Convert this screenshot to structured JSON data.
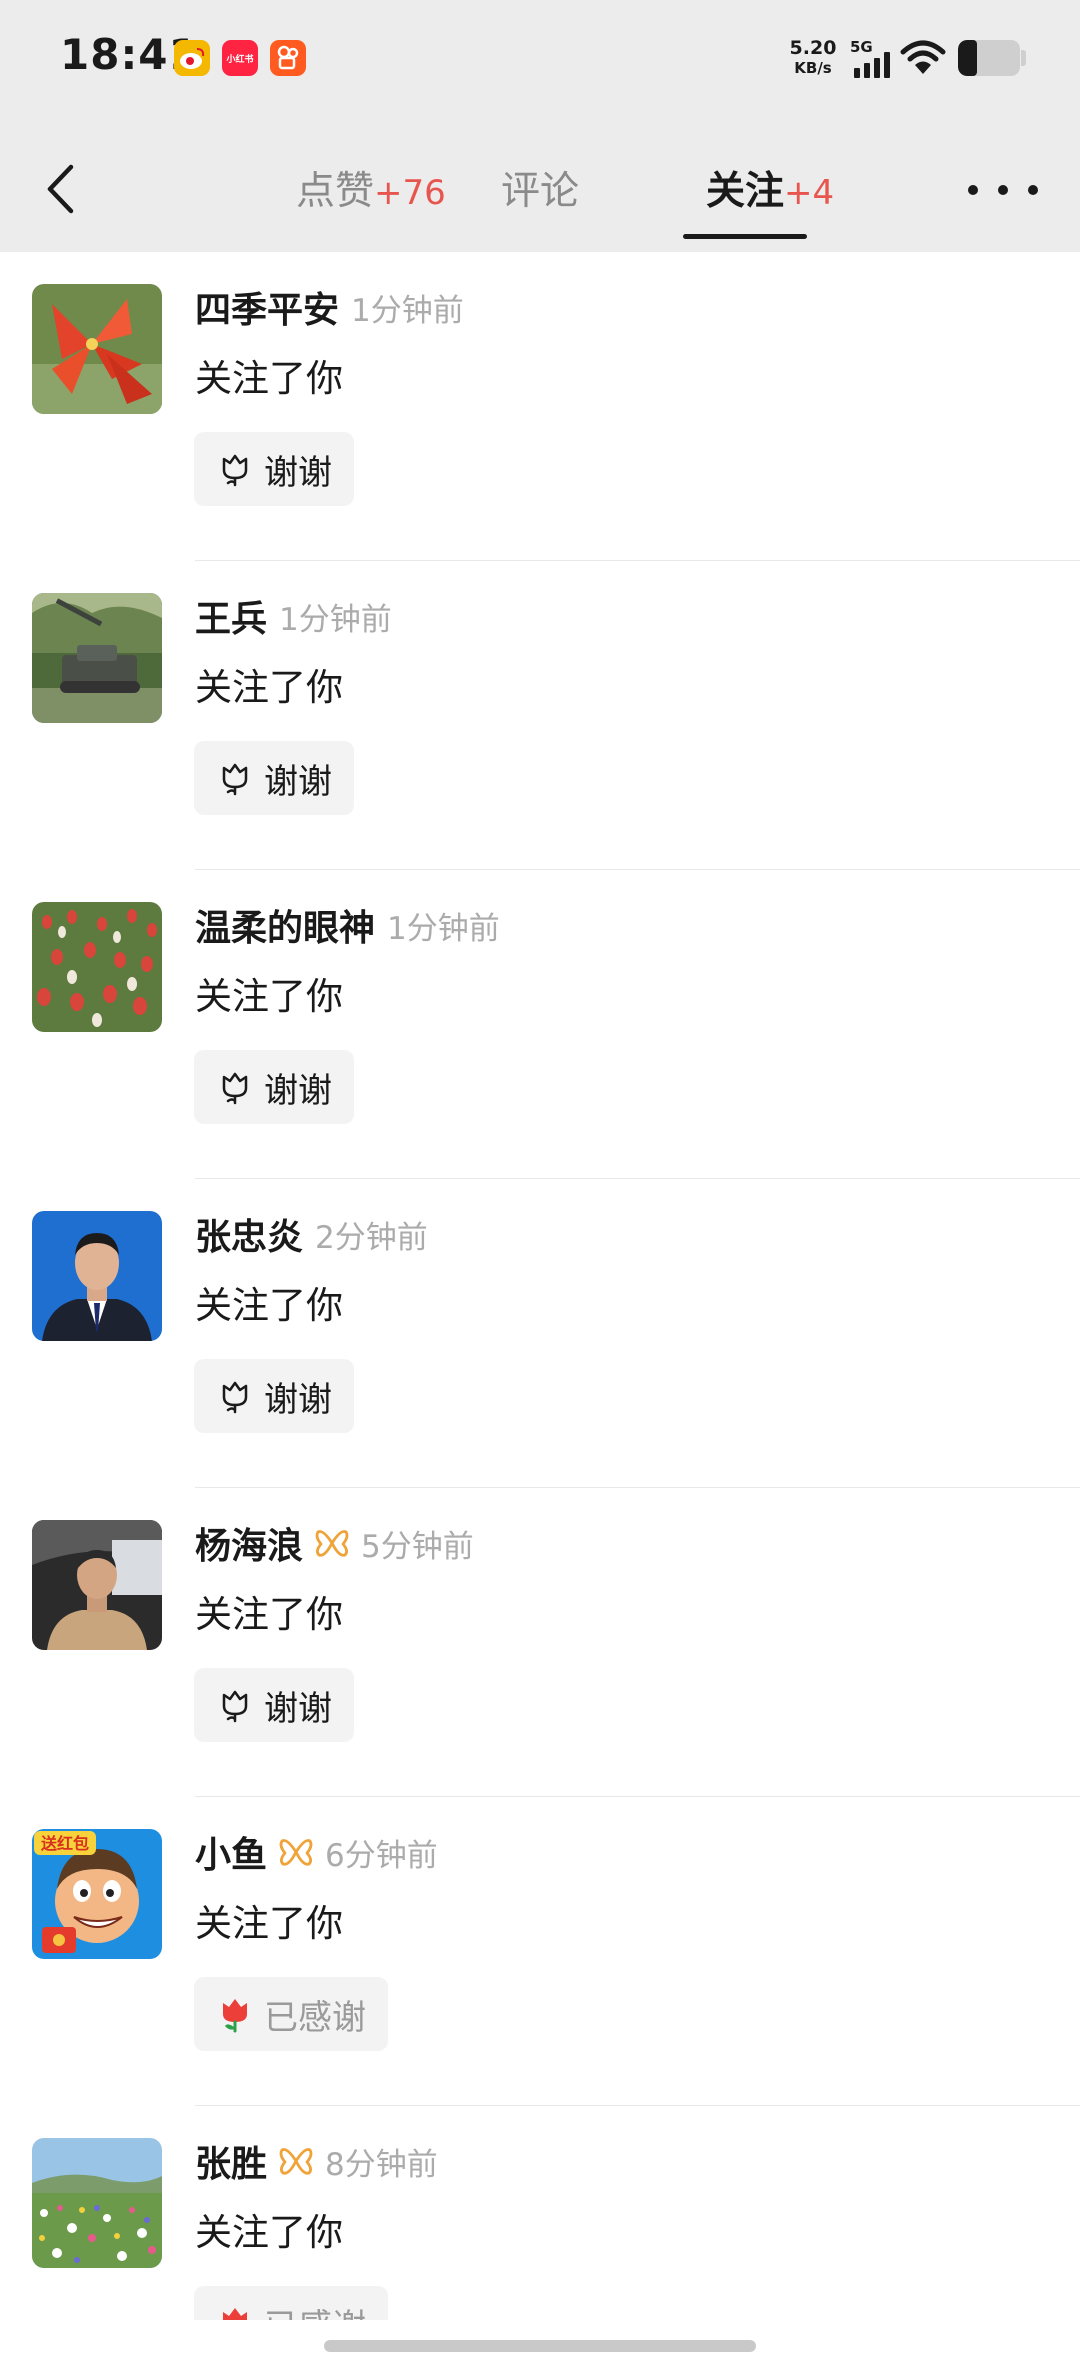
{
  "status_bar": {
    "time": "18:41",
    "app_icons": [
      {
        "name": "weibo-icon",
        "color": "#f5b800"
      },
      {
        "name": "xiaohongshu-icon",
        "label": "小红书",
        "color": "#ff2442"
      },
      {
        "name": "kuaishou-icon",
        "color": "#ff5a1f"
      }
    ],
    "net_speed": "5.20",
    "net_speed_unit": "KB/s",
    "network_type": "5G",
    "battery_level": 0.3
  },
  "header": {
    "tabs": [
      {
        "label": "点赞",
        "count": "+76",
        "active": false
      },
      {
        "label": "评论",
        "count": "",
        "active": false
      },
      {
        "label": "关注",
        "count": "+4",
        "active": true
      }
    ],
    "accent_color": "#e8554e"
  },
  "notifications": [
    {
      "name": "四季平安",
      "badge": false,
      "time": "1分钟前",
      "action": "关注了你",
      "button": "谢谢",
      "thanked": false,
      "avatar": "red-lily-flowers"
    },
    {
      "name": "王兵",
      "badge": false,
      "time": "1分钟前",
      "action": "关注了你",
      "button": "谢谢",
      "thanked": false,
      "avatar": "tank-in-park"
    },
    {
      "name": "温柔的眼神",
      "badge": false,
      "time": "1分钟前",
      "action": "关注了你",
      "button": "谢谢",
      "thanked": false,
      "avatar": "tulip-field"
    },
    {
      "name": "张忠炎",
      "badge": false,
      "time": "2分钟前",
      "action": "关注了你",
      "button": "谢谢",
      "thanked": false,
      "avatar": "man-portrait-blue-background"
    },
    {
      "name": "杨海浪",
      "badge": true,
      "time": "5分钟前",
      "action": "关注了你",
      "button": "谢谢",
      "thanked": false,
      "avatar": "man-in-car"
    },
    {
      "name": "小鱼",
      "badge": true,
      "time": "6分钟前",
      "action": "关注了你",
      "button": "已感谢",
      "thanked": true,
      "avatar": "cartoon-red-packet-character",
      "avatar_text": "送红包"
    },
    {
      "name": "张胜",
      "badge": true,
      "time": "8分钟前",
      "action": "关注了你",
      "button": "已感谢",
      "thanked": true,
      "avatar": "wildflower-meadow"
    }
  ]
}
